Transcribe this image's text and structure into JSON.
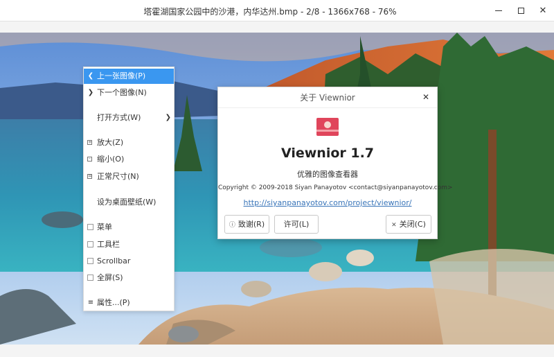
{
  "window": {
    "title": "塔霍湖国家公园中的沙港，内华达州.bmp - 2/8 - 1366x768 - 76%"
  },
  "context_menu": {
    "items": [
      {
        "label": "上一张图像(P)",
        "icon": "chevron-left-icon"
      },
      {
        "label": "下一个图像(N)",
        "icon": "chevron-right-icon"
      },
      {
        "label": "打开方式(W)",
        "icon": "submenu-arrow-icon"
      },
      {
        "label": "放大(Z)",
        "icon": "zoom-in-icon"
      },
      {
        "label": "缩小(O)",
        "icon": "zoom-out-icon"
      },
      {
        "label": "正常尺寸(N)",
        "icon": "zoom-normal-icon"
      },
      {
        "label": "设为桌面壁纸(W)"
      },
      {
        "label": "菜单",
        "checked": false
      },
      {
        "label": "工具栏",
        "checked": false
      },
      {
        "label": "Scrollbar",
        "checked": false
      },
      {
        "label": "全屏(S)",
        "checked": false
      },
      {
        "label": "属性...(P)",
        "icon": "properties-icon"
      }
    ],
    "active_index": 0
  },
  "about_dialog": {
    "title": "关于 Viewnior",
    "app_name": "Viewnior 1.7",
    "description": "优雅的图像查看器",
    "copyright": "Copyright © 2009-2018 Siyan Panayotov <contact@siyanpanayotov.com>",
    "link": "http://siyanpanayotov.com/project/viewnior/",
    "buttons": {
      "credits": "致谢(R)",
      "license": "许可(L)",
      "close": "关闭(C)"
    },
    "logo_color": "#e0455b"
  },
  "colors": {
    "menu_highlight": "#3a97f0",
    "link": "#3874b8"
  }
}
